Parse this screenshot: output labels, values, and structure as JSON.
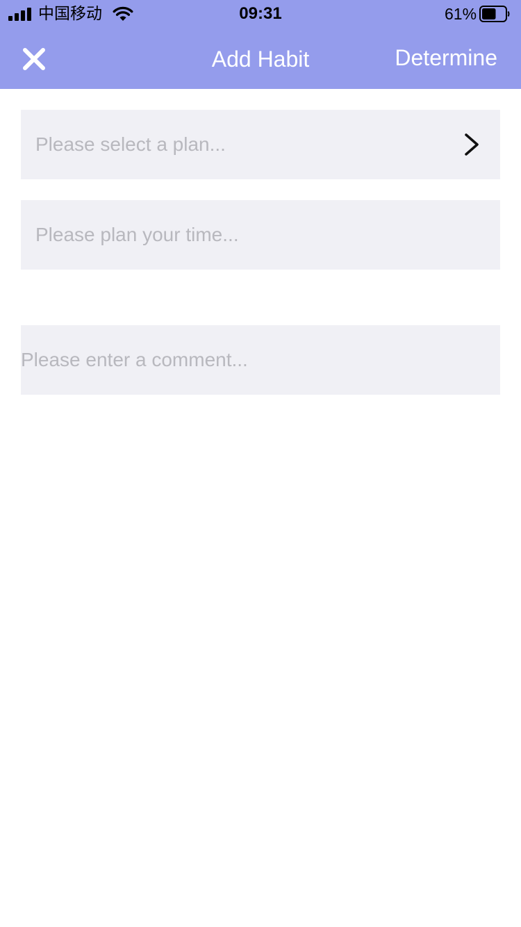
{
  "status_bar": {
    "carrier": "中国移动",
    "time": "09:31",
    "battery_percent": "61%",
    "battery_level": 0.61,
    "icons": [
      "signal-icon",
      "wifi-icon",
      "battery-icon"
    ]
  },
  "nav": {
    "close_icon": "close-icon",
    "title": "Add Habit",
    "determine_label": "Determine"
  },
  "form": {
    "plan": {
      "placeholder": "Please select a plan...",
      "value": "",
      "icon": "chevron-right-icon"
    },
    "time": {
      "placeholder": "Please plan your time...",
      "value": ""
    },
    "comment": {
      "placeholder": "Please enter a comment...",
      "value": ""
    }
  },
  "colors": {
    "header_bg": "#949cec",
    "field_bg": "#f0f0f5",
    "placeholder": "#b8b8be",
    "header_text": "#ffffff"
  }
}
